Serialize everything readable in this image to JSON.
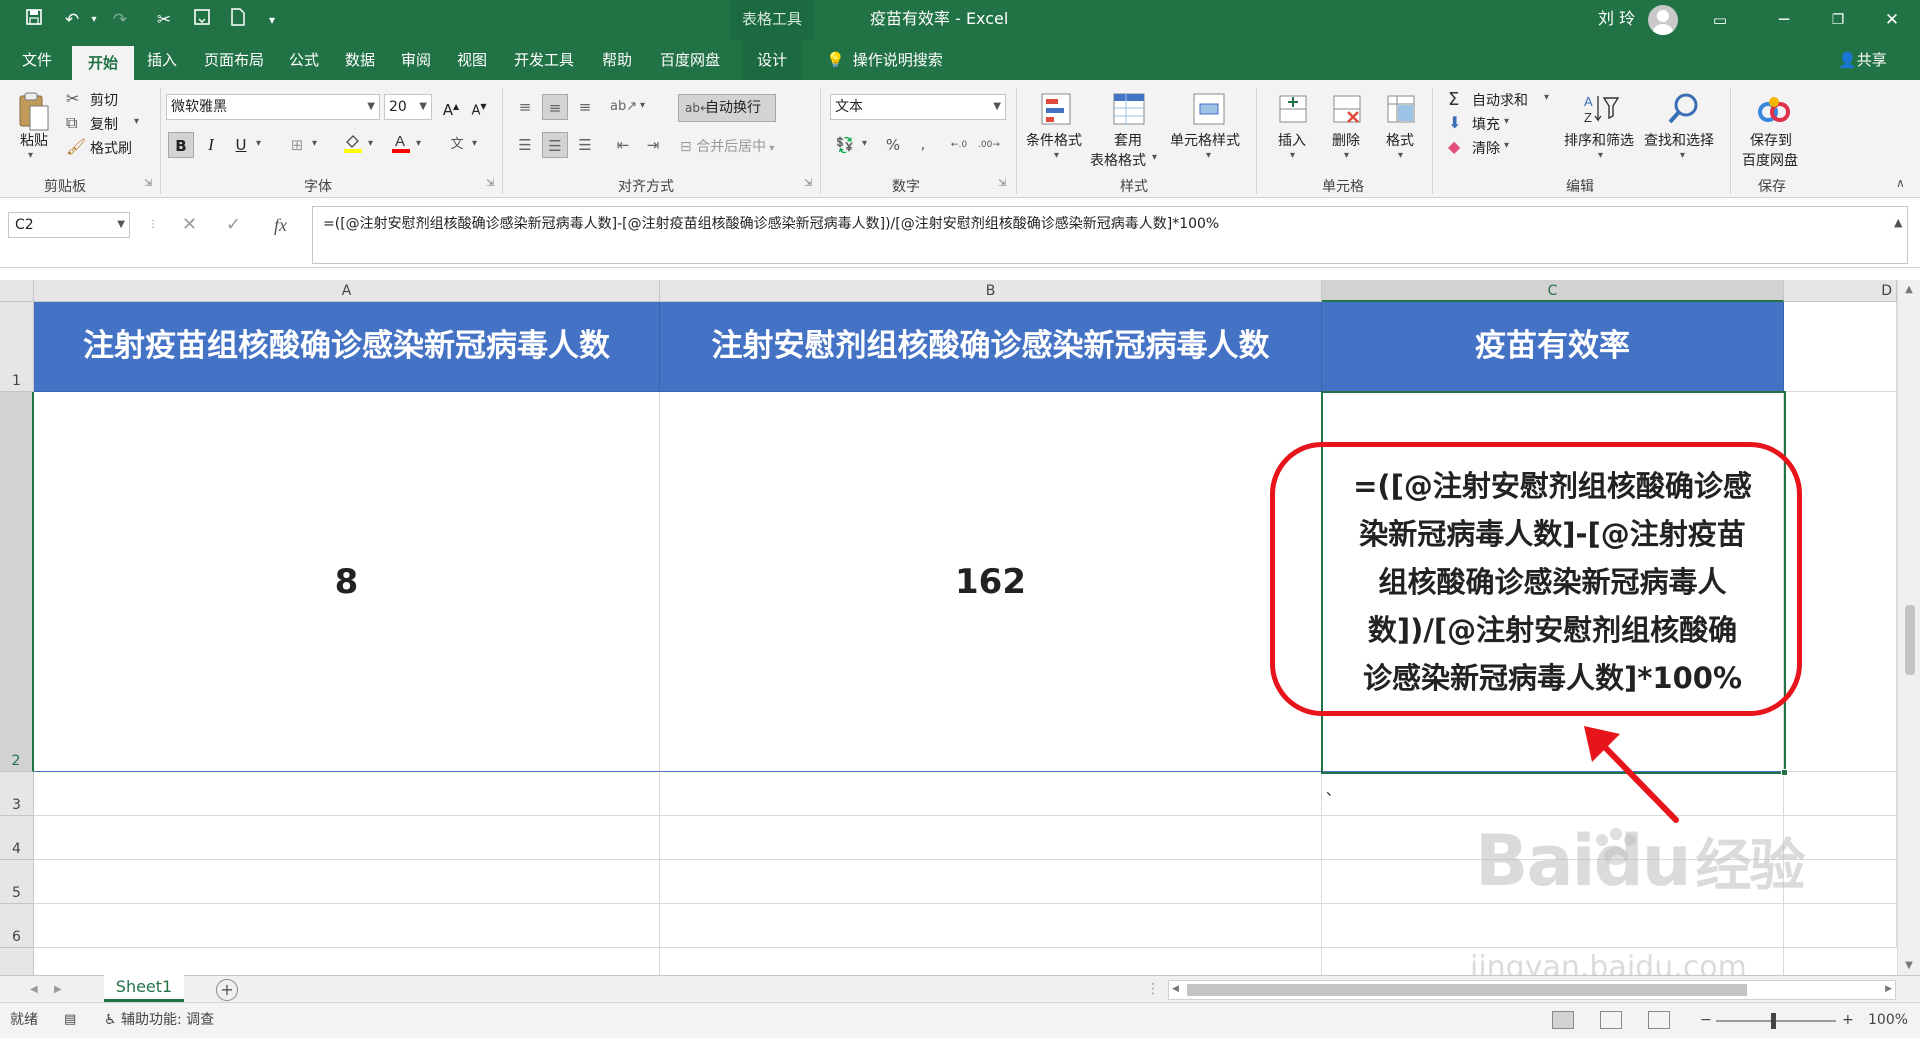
{
  "titlebar": {
    "context_tab": "表格工具",
    "doc_title": "疫苗有效率 - Excel",
    "user": "刘 玲",
    "accent": "#217346"
  },
  "tabs": [
    "文件",
    "开始",
    "插入",
    "页面布局",
    "公式",
    "数据",
    "审阅",
    "视图",
    "开发工具",
    "帮助",
    "百度网盘",
    "设计"
  ],
  "active_tab": "开始",
  "tell_me": "操作说明搜索",
  "share": "共享",
  "ribbon": {
    "clipboard": {
      "paste": "粘贴",
      "cut": "剪切",
      "copy": "复制",
      "format_painter": "格式刷",
      "label": "剪贴板"
    },
    "font": {
      "name": "微软雅黑",
      "size": "20",
      "label": "字体",
      "bold": "B",
      "italic": "I",
      "underline": "U",
      "font_color": "#ff0000",
      "fill_color": "#ffff00"
    },
    "alignment": {
      "wrap_text": "自动换行",
      "merge_center": "合并后居中",
      "label": "对齐方式"
    },
    "number": {
      "format": "文本",
      "label": "数字"
    },
    "styles": {
      "conditional": "条件格式",
      "table_format_1": "套用",
      "table_format_2": "表格格式",
      "cell_styles": "单元格样式",
      "label": "样式"
    },
    "cells": {
      "insert": "插入",
      "delete": "删除",
      "format": "格式",
      "label": "单元格"
    },
    "editing": {
      "autosum": "自动求和",
      "fill": "填充",
      "clear": "清除",
      "sort_filter": "排序和筛选",
      "find_select": "查找和选择",
      "label": "编辑"
    },
    "save": {
      "save_to_1": "保存到",
      "save_to_2": "百度网盘",
      "label": "保存"
    }
  },
  "formula_bar": {
    "name_box": "C2",
    "formula": "=([@注射安慰剂组核酸确诊感染新冠病毒人数]-[@注射疫苗组核酸确诊感染新冠病毒人数])/[@注射安慰剂组核酸确诊感染新冠病毒人数]*100%"
  },
  "columns": [
    "A",
    "B",
    "C",
    "D"
  ],
  "rows": [
    "1",
    "2",
    "3",
    "4",
    "5",
    "6"
  ],
  "table": {
    "headers": [
      "注射疫苗组核酸确诊感染新冠病毒人数",
      "注射安慰剂组核酸确诊感染新冠病毒人数",
      "疫苗有效率"
    ],
    "values": [
      "8",
      "162"
    ],
    "formula_lines": [
      "=([@注射安慰剂组核酸确诊感",
      "染新冠病毒人数]-[@注射疫苗",
      "组核酸确诊感染新冠病毒人",
      "数])/[@注射安慰剂组核酸确",
      "诊感染新冠病毒人数]*100%"
    ],
    "header_color": "#4472c4",
    "c3_mark": "、"
  },
  "sheet": {
    "name": "Sheet1"
  },
  "status": {
    "ready": "就绪",
    "accessibility": "辅助功能: 调查",
    "zoom": "100%"
  },
  "watermark": {
    "brand": "Baidu",
    "brand_cn": "经验",
    "url": "jingyan.baidu.com"
  }
}
